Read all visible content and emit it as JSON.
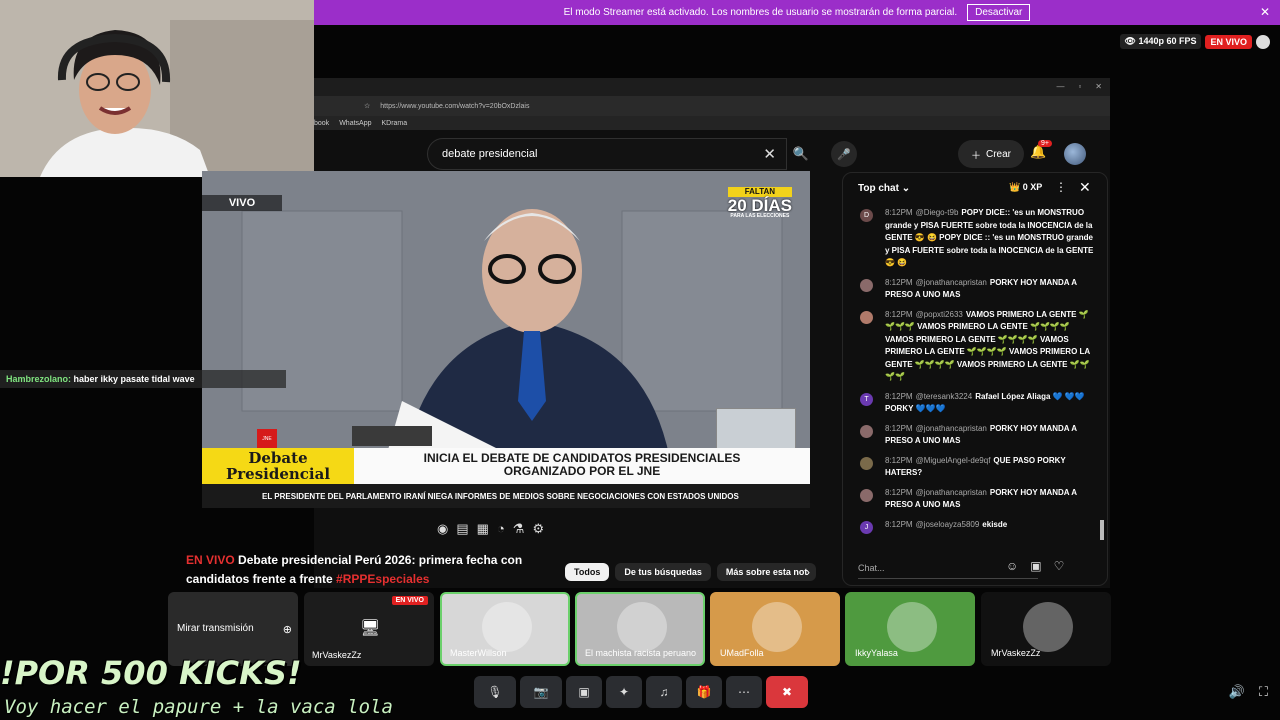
{
  "banner": {
    "text": "El modo Streamer está activado. Los nombres de usuario se mostrarán de forma parcial.",
    "button": "Desactivar",
    "close": "✕"
  },
  "status": {
    "quality": "1440p 60 FPS",
    "live": "EN VIVO"
  },
  "browser": {
    "url": "https://www.youtube.com/watch?v=20bOxDzlais",
    "bookmarks": [
      "book",
      "WhatsApp",
      "KDrama"
    ],
    "controls": [
      "—",
      "▫",
      "✕"
    ]
  },
  "youtube": {
    "search_value": "debate presidencial",
    "create_label": "Crear",
    "notif_count": "9+"
  },
  "video": {
    "vivo": "VIVO",
    "faltan": "FALTAN",
    "days": "20 DÍAS",
    "days_sub": "PARA LAS ELECCIONES",
    "jne": "JNE",
    "lower_left_1": "Debate",
    "lower_left_2": "Presidencial",
    "headline_1": "INICIA EL DEBATE DE CANDIDATOS PRESIDENCIALES",
    "headline_2": "ORGANIZADO POR EL JNE",
    "ticker": "EL PRESIDENTE DEL PARLAMENTO IRANÍ NIEGA INFORMES DE MEDIOS SOBRE NEGOCIACIONES CON ESTADOS UNIDOS",
    "title_live": "EN VIVO",
    "title_text": "Debate presidencial Perú 2026: primera fecha con candidatos frente a frente",
    "title_tag": "#RPPEspeciales"
  },
  "chips": [
    "Todos",
    "De tus búsquedas",
    "Más sobre esta not"
  ],
  "chat": {
    "header": "Top chat",
    "xp": "0 XP",
    "input_placeholder": "Chat...",
    "messages": [
      {
        "initial": "D",
        "color": "#6b4a4a",
        "time": "8:12PM",
        "user": "@Diego-t9b",
        "text": "POPY DICE:: 'es un MONSTRUO grande y PISA FUERTE sobre toda la INOCENCIA de la GENTE 😎 😆 POPY DICE :: 'es un MONSTRUO grande y PISA FUERTE sobre toda la INOCENCIA de la GENTE 😎 😆"
      },
      {
        "initial": "",
        "color": "#8a6a6a",
        "time": "8:12PM",
        "user": "@jonathancapristan",
        "text": "PORKY HOY MANDA A PRESO A UNO MAS"
      },
      {
        "initial": "",
        "color": "#b07a6a",
        "time": "8:12PM",
        "user": "@popxti2633",
        "text": "VAMOS PRIMERO LA GENTE 🌱🌱🌱🌱 VAMOS PRIMERO LA GENTE 🌱🌱🌱🌱 VAMOS PRIMERO LA GENTE 🌱🌱🌱🌱 VAMOS PRIMERO LA GENTE 🌱🌱🌱🌱 VAMOS PRIMERO LA GENTE 🌱🌱🌱🌱 VAMOS PRIMERO LA GENTE 🌱🌱🌱🌱"
      },
      {
        "initial": "T",
        "color": "#6a3ab0",
        "time": "8:12PM",
        "user": "@teresank3224",
        "text": "Rafael López Aliaga 💙 💙💙 PORKY 💙💙💙"
      },
      {
        "initial": "",
        "color": "#8a6a6a",
        "time": "8:12PM",
        "user": "@jonathancapristan",
        "text": "PORKY HOY MANDA A PRESO A UNO MAS"
      },
      {
        "initial": "",
        "color": "#7a6a4a",
        "time": "8:12PM",
        "user": "@MiguelAngel-de9qf",
        "text": "QUE PASO PORKY HATERS?"
      },
      {
        "initial": "",
        "color": "#8a6a6a",
        "time": "8:12PM",
        "user": "@jonathancapristan",
        "text": "PORKY HOY MANDA A PRESO A UNO MAS"
      },
      {
        "initial": "J",
        "color": "#6a3ab0",
        "time": "8:12PM",
        "user": "@joseloayza5809",
        "text": "ekisde"
      }
    ]
  },
  "overlay": {
    "chat_user": "Hambrezolano:",
    "chat_text": "haber ikky pasate tidal wave",
    "promo_1": "!POR 500 KICKS!",
    "promo_2": "Voy hacer el papure + la vaca lola"
  },
  "tiles": {
    "mirar": "Mirar transmisión",
    "webcam_name": "MrVaskezZz",
    "stream_name": "MrVaskezZz",
    "stream_live": "EN VIVO",
    "users": [
      {
        "name": "MasterWillson",
        "bg": "#d7d7d7",
        "border": "#6bd06b"
      },
      {
        "name": "El machista racista peruano",
        "bg": "#b9b9b9",
        "border": "#6bd06b"
      },
      {
        "name": "UMadFolla",
        "bg": "#d69a4a",
        "border": "#d69a4a"
      },
      {
        "name": "IkkyYalasa",
        "bg": "#4f9a3f",
        "border": "#4f9a3f"
      },
      {
        "name": "MrVaskezZz",
        "bg": "#111111",
        "border": "#111111"
      }
    ]
  },
  "colors": {
    "accent_purple": "#9b2ec9",
    "live_red": "#e02020",
    "hangup_red": "#da373c"
  }
}
